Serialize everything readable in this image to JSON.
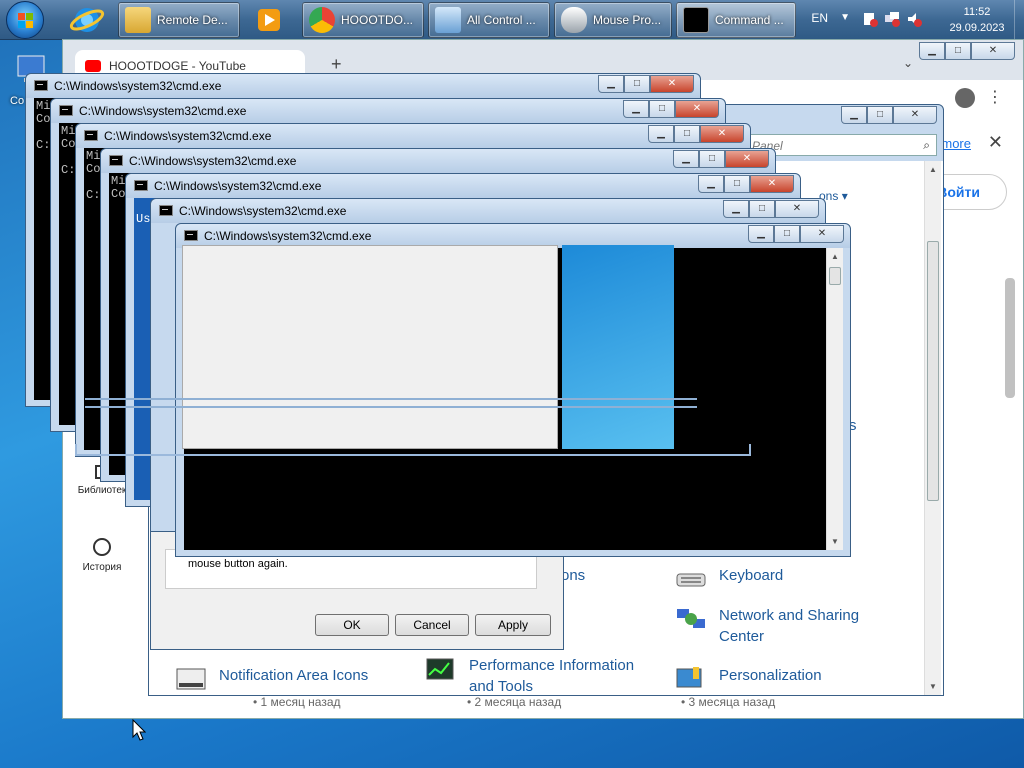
{
  "taskbar": {
    "start_label": "Start",
    "buttons": [
      {
        "label": "Remote De..."
      },
      {
        "label": "HOOOTDO..."
      },
      {
        "label": "All Control ..."
      },
      {
        "label": "Mouse Pro..."
      },
      {
        "label": "Command ..."
      }
    ],
    "tray": {
      "language": "EN",
      "time": "11:52",
      "date": "29.09.2023"
    }
  },
  "desktop": {
    "icon_label": "Co"
  },
  "chrome": {
    "tab_title": "HOOOTDOGE - YouTube",
    "new_tab": "+",
    "info_link": "more",
    "sign_in": "Войти",
    "sidebar": [
      {
        "label": "Библиотек"
      },
      {
        "label": "История"
      }
    ],
    "video_times": [
      "• 1 месяц назад",
      "• 2 месяца назад",
      "• 3 месяца назад"
    ]
  },
  "control_panel": {
    "search_placeholder": "l Panel",
    "view_by": "ons",
    "items": [
      {
        "label": "Keyboard"
      },
      {
        "label": "Network and Sharing Center"
      },
      {
        "label": "Notification Area Icons"
      },
      {
        "label": "Performance Information and Tools"
      },
      {
        "label": "Personalization"
      }
    ],
    "partial_labels": [
      "ons",
      "s"
    ]
  },
  "mouse_properties": {
    "note": "mouse button again.",
    "ok": "OK",
    "cancel": "Cancel",
    "apply": "Apply"
  },
  "cmd": {
    "title": "C:\\Windows\\system32\\cmd.exe",
    "fragments": [
      "Mi",
      "Co",
      "C:",
      "Us"
    ]
  }
}
